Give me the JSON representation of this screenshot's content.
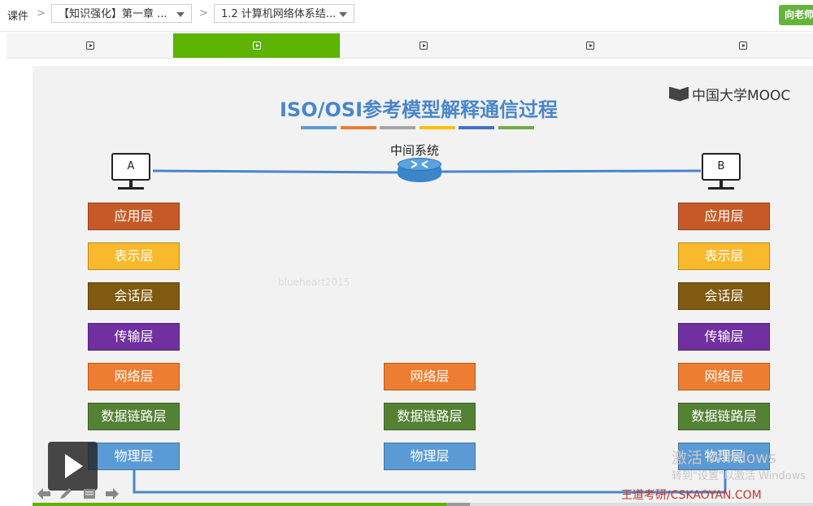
{
  "breadcrumb": {
    "root": "课件",
    "course_select": "【知识强化】第一章 ...",
    "section_select": "1.2 计算机网络体系结..."
  },
  "ask_button": "向老师",
  "tabs": [
    {
      "active": false
    },
    {
      "active": true
    },
    {
      "active": false
    },
    {
      "active": false
    },
    {
      "active": false
    }
  ],
  "slide": {
    "title": "ISO/OSI参考模型解释通信过程",
    "logo_text": "中国大学MOOC",
    "underline_colors": [
      "#5b9bd5",
      "#ed7d31",
      "#a5a5a5",
      "#ffc000",
      "#4472c4",
      "#70ad47"
    ],
    "host_a": "A",
    "host_b": "B",
    "intermediate_label": "中间系统",
    "end_layers": [
      {
        "label": "应用层",
        "color": "#c55a28"
      },
      {
        "label": "表示层",
        "color": "#f9b92c"
      },
      {
        "label": "会话层",
        "color": "#7f5a10"
      },
      {
        "label": "传输层",
        "color": "#7030a0"
      },
      {
        "label": "网络层",
        "color": "#ed7d31"
      },
      {
        "label": "数据链路层",
        "color": "#548235"
      },
      {
        "label": "物理层",
        "color": "#5b9bd5"
      }
    ],
    "mid_layers": [
      {
        "label": "网络层",
        "color": "#ed7d31"
      },
      {
        "label": "数据链路层",
        "color": "#548235"
      },
      {
        "label": "物理层",
        "color": "#5b9bd5"
      }
    ],
    "watermark": "blueheart2015",
    "activation_line1": "激活 Windows",
    "activation_line2": "转到\"设置\"以激活 Windows",
    "kaoyan": "王道考研/CSKAOYAN.COM"
  },
  "player": {
    "progress_fraction": 0.53,
    "buffered_fraction": 0.56
  }
}
